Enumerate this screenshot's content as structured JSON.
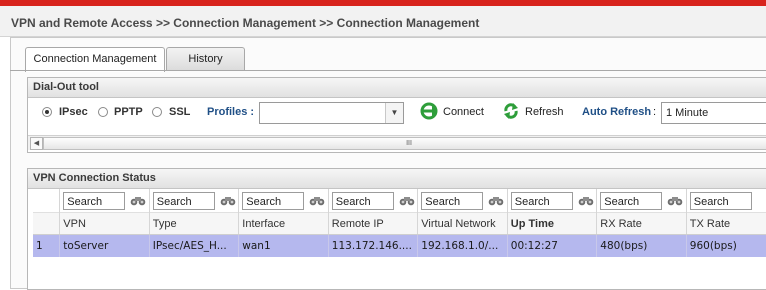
{
  "breadcrumb": "VPN and Remote Access >> Connection Management >> Connection Management",
  "tabs": [
    {
      "label": "Connection Management",
      "active": true
    },
    {
      "label": "History",
      "active": false
    }
  ],
  "dialout": {
    "title": "Dial-Out tool",
    "radios": [
      {
        "label": "IPsec",
        "selected": true
      },
      {
        "label": "PPTP",
        "selected": false
      },
      {
        "label": "SSL",
        "selected": false
      }
    ],
    "profiles_label": "Profiles :",
    "profiles_value": "",
    "connect_label": "Connect",
    "refresh_label": "Refresh",
    "auto_refresh_label": "Auto Refresh",
    "auto_refresh_sep": ":",
    "auto_refresh_value": "1 Minute",
    "scroll_grip": "III"
  },
  "status": {
    "title": "VPN Connection Status",
    "search_placeholder": "Search",
    "columns": [
      "",
      "VPN",
      "Type",
      "Interface",
      "Remote IP",
      "Virtual Network",
      "Up Time",
      "RX Rate",
      "TX Rate"
    ],
    "sorted_column": "Up Time",
    "rows": [
      [
        "1",
        "toServer",
        "IPsec/AES_H...",
        "wan1",
        "113.172.146....",
        "192.168.1.0/...",
        "00:12:27",
        "480(bps)",
        "960(bps)"
      ]
    ]
  },
  "colors": {
    "accent_red": "#d8241d",
    "label_blue": "#1f4f86",
    "selected_row": "#b5b8ee",
    "icon_green": "#2e9e3a"
  }
}
